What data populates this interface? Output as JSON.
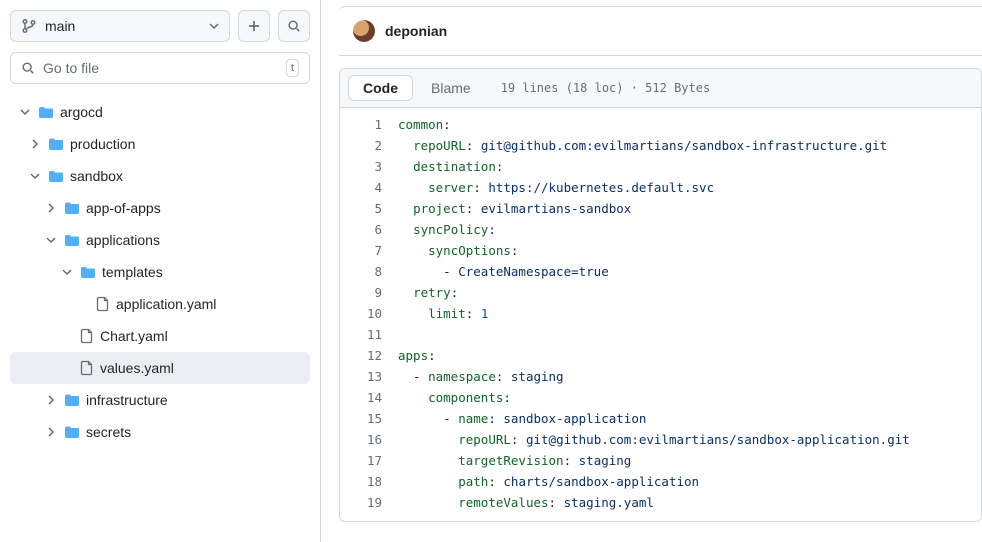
{
  "branch": {
    "name": "main"
  },
  "gotofile": {
    "placeholder": "Go to file",
    "shortcut": "t"
  },
  "tree": [
    {
      "depth": 0,
      "type": "folder",
      "expanded": true,
      "name": "argocd",
      "selected": false
    },
    {
      "depth": 1,
      "type": "folder",
      "expanded": false,
      "name": "production",
      "selected": false
    },
    {
      "depth": 1,
      "type": "folder",
      "expanded": true,
      "name": "sandbox",
      "selected": false
    },
    {
      "depth": 2,
      "type": "folder",
      "expanded": false,
      "name": "app-of-apps",
      "selected": false
    },
    {
      "depth": 2,
      "type": "folder",
      "expanded": true,
      "name": "applications",
      "selected": false
    },
    {
      "depth": 3,
      "type": "folder",
      "expanded": true,
      "name": "templates",
      "selected": false
    },
    {
      "depth": 4,
      "type": "file",
      "expanded": null,
      "name": "application.yaml",
      "selected": false
    },
    {
      "depth": 3,
      "type": "file",
      "expanded": null,
      "name": "Chart.yaml",
      "selected": false
    },
    {
      "depth": 3,
      "type": "file",
      "expanded": null,
      "name": "values.yaml",
      "selected": true
    },
    {
      "depth": 2,
      "type": "folder",
      "expanded": false,
      "name": "infrastructure",
      "selected": false
    },
    {
      "depth": 2,
      "type": "folder",
      "expanded": false,
      "name": "secrets",
      "selected": false
    }
  ],
  "author": {
    "name": "deponian"
  },
  "tabs": {
    "code": "Code",
    "blame": "Blame"
  },
  "meta": {
    "text": "19 lines (18 loc) · 512 Bytes"
  },
  "code": [
    [
      [
        "key",
        "common"
      ],
      [
        "punc",
        ":"
      ]
    ],
    [
      [
        "plain",
        "  "
      ],
      [
        "key",
        "repoURL"
      ],
      [
        "punc",
        ": "
      ],
      [
        "str",
        "git@github.com:evilmartians/sandbox-infrastructure.git"
      ]
    ],
    [
      [
        "plain",
        "  "
      ],
      [
        "key",
        "destination"
      ],
      [
        "punc",
        ":"
      ]
    ],
    [
      [
        "plain",
        "    "
      ],
      [
        "key",
        "server"
      ],
      [
        "punc",
        ": "
      ],
      [
        "str",
        "https://kubernetes.default.svc"
      ]
    ],
    [
      [
        "plain",
        "  "
      ],
      [
        "key",
        "project"
      ],
      [
        "punc",
        ": "
      ],
      [
        "str",
        "evilmartians-sandbox"
      ]
    ],
    [
      [
        "plain",
        "  "
      ],
      [
        "key",
        "syncPolicy"
      ],
      [
        "punc",
        ":"
      ]
    ],
    [
      [
        "plain",
        "    "
      ],
      [
        "key",
        "syncOptions"
      ],
      [
        "punc",
        ":"
      ]
    ],
    [
      [
        "plain",
        "      - "
      ],
      [
        "str",
        "CreateNamespace=true"
      ]
    ],
    [
      [
        "plain",
        "  "
      ],
      [
        "key",
        "retry"
      ],
      [
        "punc",
        ":"
      ]
    ],
    [
      [
        "plain",
        "    "
      ],
      [
        "key",
        "limit"
      ],
      [
        "punc",
        ": "
      ],
      [
        "num",
        "1"
      ]
    ],
    [],
    [
      [
        "key",
        "apps"
      ],
      [
        "punc",
        ":"
      ]
    ],
    [
      [
        "plain",
        "  - "
      ],
      [
        "key",
        "namespace"
      ],
      [
        "punc",
        ": "
      ],
      [
        "str",
        "staging"
      ]
    ],
    [
      [
        "plain",
        "    "
      ],
      [
        "key",
        "components"
      ],
      [
        "punc",
        ":"
      ]
    ],
    [
      [
        "plain",
        "      - "
      ],
      [
        "key",
        "name"
      ],
      [
        "punc",
        ": "
      ],
      [
        "str",
        "sandbox-application"
      ]
    ],
    [
      [
        "plain",
        "        "
      ],
      [
        "key",
        "repoURL"
      ],
      [
        "punc",
        ": "
      ],
      [
        "str",
        "git@github.com:evilmartians/sandbox-application.git"
      ]
    ],
    [
      [
        "plain",
        "        "
      ],
      [
        "key",
        "targetRevision"
      ],
      [
        "punc",
        ": "
      ],
      [
        "str",
        "staging"
      ]
    ],
    [
      [
        "plain",
        "        "
      ],
      [
        "key",
        "path"
      ],
      [
        "punc",
        ": "
      ],
      [
        "str",
        "charts/sandbox-application"
      ]
    ],
    [
      [
        "plain",
        "        "
      ],
      [
        "key",
        "remoteValues"
      ],
      [
        "punc",
        ": "
      ],
      [
        "str",
        "staging.yaml"
      ]
    ]
  ]
}
